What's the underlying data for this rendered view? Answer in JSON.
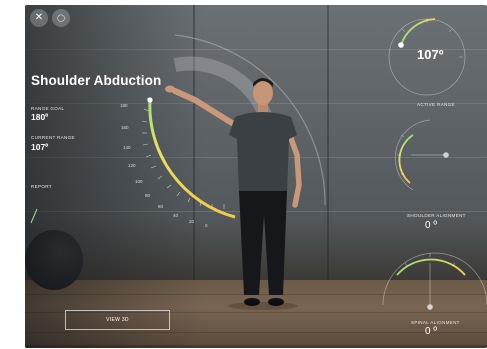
{
  "exercise": {
    "title": "Shoulder Abduction"
  },
  "metrics": {
    "range_goal_label": "RANGE GOAL",
    "range_goal_value": "180º",
    "current_range_label": "CURRENT RANGE",
    "current_range_value": "107º",
    "report_label": "REPORT"
  },
  "gauges": {
    "active_range_value": "107º",
    "active_range_label": "ACTIVE RANGE",
    "shoulder_alignment_value": "0 º",
    "shoulder_alignment_label": "SHOULDER ALIGNMENT",
    "spinal_alignment_value": "0 º",
    "spinal_alignment_label": "SPINAL ALIGNMENT"
  },
  "main_dial": {
    "ticks": [
      "180",
      "160",
      "140",
      "120",
      "100",
      "80",
      "60",
      "40",
      "20",
      "0"
    ],
    "progress": 107
  },
  "controls": {
    "close_glyph": "✕",
    "reset_glyph": "◯",
    "view_3d_label": "VIEW 3D"
  },
  "colors": {
    "gauge_green": "#9fe07a",
    "gauge_yellow": "#f3d55b",
    "accent_white": "#ffffff"
  }
}
